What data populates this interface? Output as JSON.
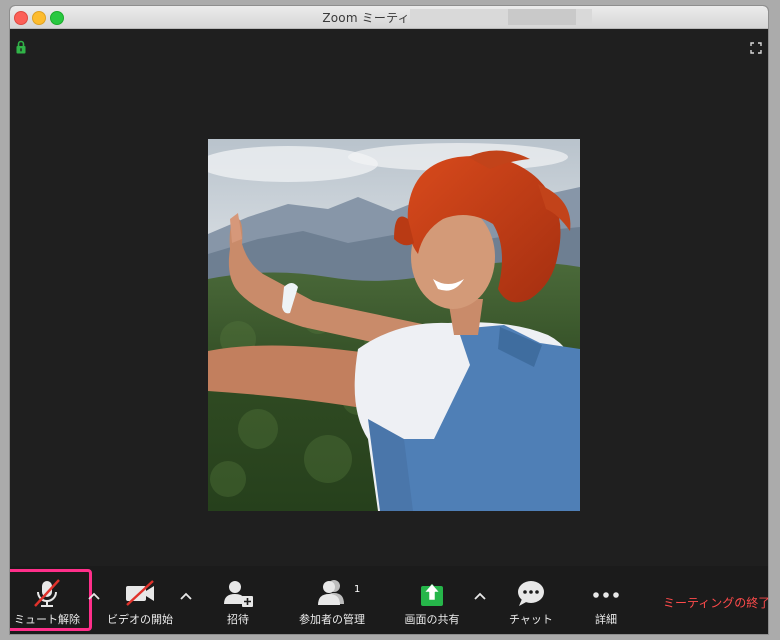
{
  "window": {
    "title": "Zoom ミーティング ID:"
  },
  "toolbar": {
    "unmute_label": "ミュート解除",
    "video_label": "ビデオの開始",
    "invite_label": "招待",
    "participants_label": "参加者の管理",
    "participants_count": "1",
    "share_label": "画面の共有",
    "chat_label": "チャット",
    "more_label": "詳細",
    "end_label": "ミーティングの終了"
  },
  "colors": {
    "highlight": "#ff2f8a",
    "share_green": "#26b64a",
    "end_red": "#ff4b4b",
    "lock_green": "#31b448"
  },
  "icons": [
    "lock-icon",
    "fullscreen-icon",
    "microphone-muted-icon",
    "video-off-icon",
    "invite-icon",
    "participants-icon",
    "share-screen-icon",
    "chat-icon",
    "more-icon"
  ]
}
